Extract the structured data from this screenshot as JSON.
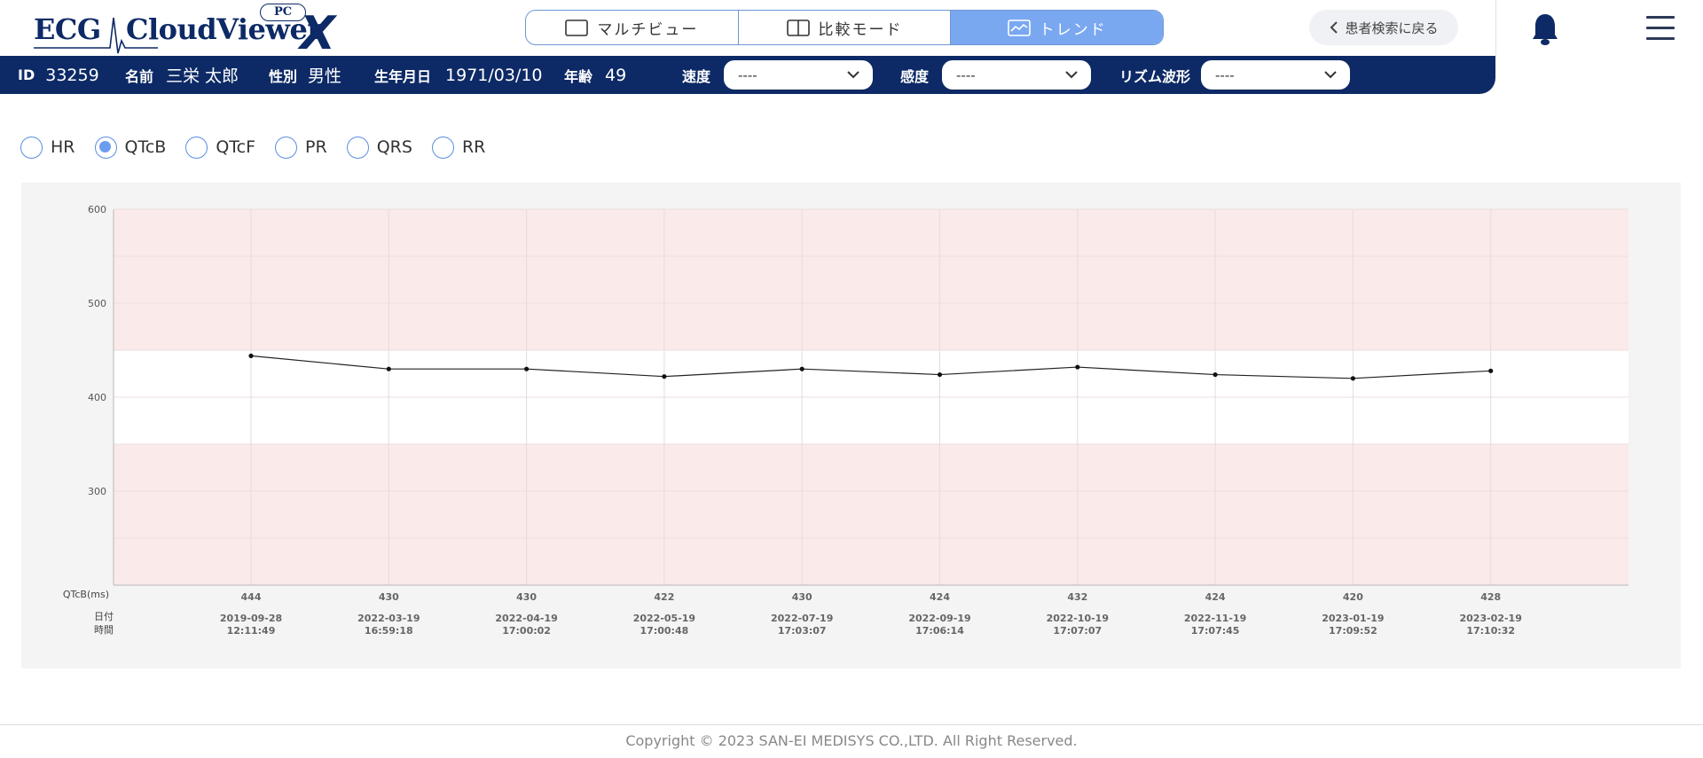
{
  "logo": {
    "ecg": "ECG",
    "cloudviewer": "CloudViewer",
    "x": "X",
    "pc": "PC"
  },
  "view_tabs": [
    {
      "label": "マルチビュー",
      "icon": "single-window-icon",
      "active": false
    },
    {
      "label": "比較モード",
      "icon": "split-window-icon",
      "active": false
    },
    {
      "label": "トレンド",
      "icon": "trend-chart-icon",
      "active": true
    }
  ],
  "back_button": {
    "label": "患者検索に戻る",
    "icon": "chevron-left-icon"
  },
  "header_icons": {
    "notification": "bell-icon",
    "menu": "hamburger-menu-icon"
  },
  "patient": {
    "id_label": "ID",
    "id": "33259",
    "name_label": "名前",
    "name": "三栄 太郎",
    "sex_label": "性別",
    "sex": "男性",
    "dob_label": "生年月日",
    "dob": "1971/03/10",
    "age_label": "年齢",
    "age": "49"
  },
  "selects": {
    "speed": {
      "label": "速度",
      "value": "----"
    },
    "sensitivity": {
      "label": "感度",
      "value": "----"
    },
    "rhythm": {
      "label": "リズム波形",
      "value": "----"
    }
  },
  "metrics": [
    {
      "label": "HR",
      "checked": false
    },
    {
      "label": "QTcB",
      "checked": true
    },
    {
      "label": "QTcF",
      "checked": false
    },
    {
      "label": "PR",
      "checked": false
    },
    {
      "label": "QRS",
      "checked": false
    },
    {
      "label": "RR",
      "checked": false
    }
  ],
  "chart_data": {
    "type": "line",
    "ylabel": "QTcB(ms)",
    "ylim": [
      200,
      600
    ],
    "yticks": [
      300,
      400,
      500,
      600
    ],
    "normal_range": [
      350,
      450
    ],
    "band_colors": {
      "abnormal": "#fbeaea",
      "normal": "#ffffff"
    },
    "line_color": "#222222",
    "grid": true,
    "row_labels": {
      "date": "日付",
      "time": "時間"
    },
    "dates": [
      "2019-09-28",
      "2022-03-19",
      "2022-04-19",
      "2022-05-19",
      "2022-07-19",
      "2022-09-19",
      "2022-10-19",
      "2022-11-19",
      "2023-01-19",
      "2023-02-19"
    ],
    "times": [
      "12:11:49",
      "16:59:18",
      "17:00:02",
      "17:00:48",
      "17:03:07",
      "17:06:14",
      "17:07:07",
      "17:07:45",
      "17:09:52",
      "17:10:32"
    ],
    "series": [
      {
        "values": [
          444,
          430,
          430,
          422,
          430,
          424,
          432,
          424,
          420,
          428
        ]
      }
    ]
  },
  "footer": {
    "copyright": "Copyright © 2023 SAN-EI MEDISYS CO.,LTD. All Right Reserved."
  }
}
